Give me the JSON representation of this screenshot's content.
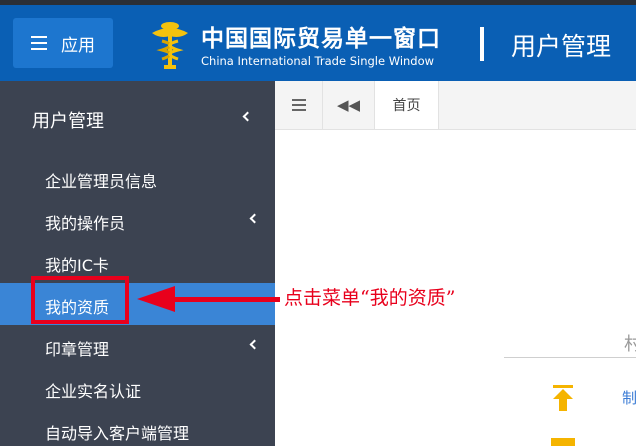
{
  "header": {
    "app_button_label": "应用",
    "title_cn": "中国国际贸易单一窗口",
    "title_en": "China International Trade Single Window",
    "module_title": "用户管理"
  },
  "sidebar": {
    "section_title": "用户管理",
    "items": [
      {
        "label": "企业管理员信息"
      },
      {
        "label": "我的操作员"
      },
      {
        "label": "我的IC卡"
      },
      {
        "label": "我的资质"
      },
      {
        "label": "印章管理"
      },
      {
        "label": "企业实名认证"
      },
      {
        "label": "自动导入客户端管理"
      }
    ]
  },
  "annotation": {
    "callout_text": "点击菜单“我的资质”"
  },
  "tabs": {
    "home_label": "首页"
  },
  "content": {
    "char1": "村",
    "char2": "制"
  },
  "colors": {
    "header_bg": "#0a5fb4",
    "sidebar_bg": "#3c4351",
    "active_item": "#3a85d6",
    "annotation_red": "#e8001c"
  }
}
